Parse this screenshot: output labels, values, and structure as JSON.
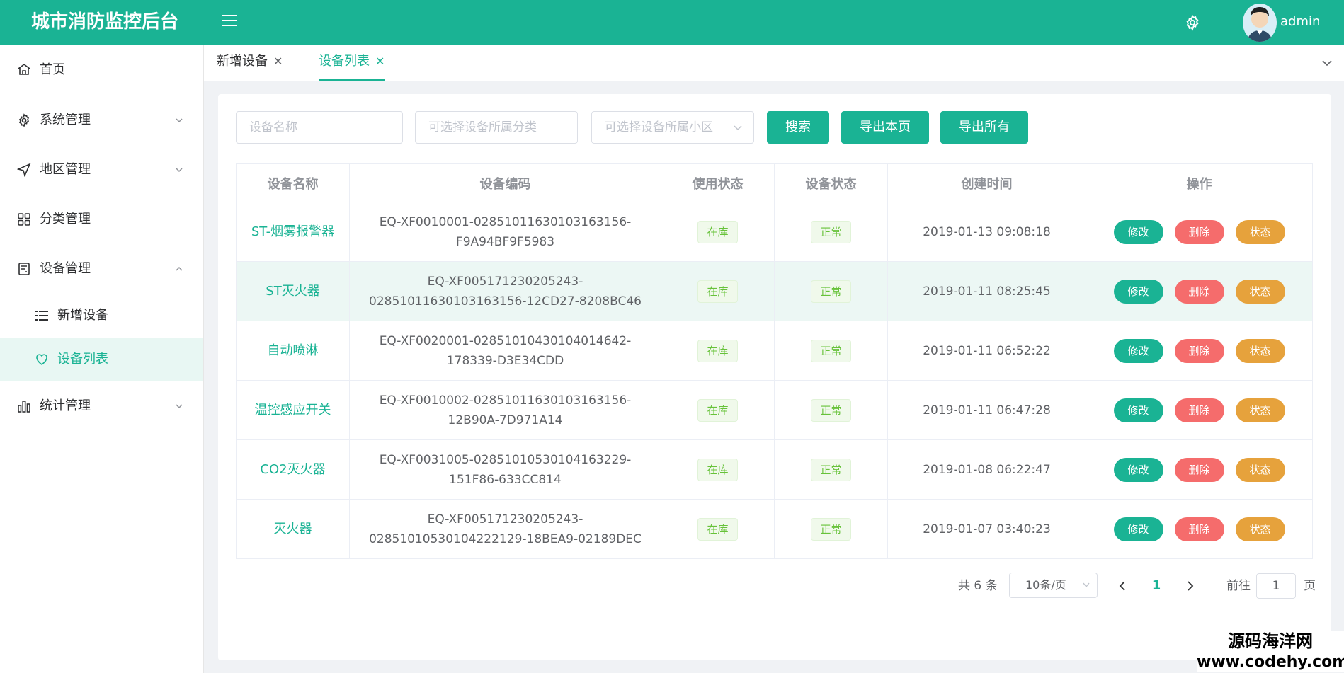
{
  "header": {
    "brand": "城市消防监控后台",
    "username": "admin"
  },
  "sidebar": {
    "items": [
      {
        "label": "首页",
        "icon": "home-icon"
      },
      {
        "label": "系统管理",
        "icon": "gear-icon"
      },
      {
        "label": "地区管理",
        "icon": "location-arrow-icon"
      },
      {
        "label": "分类管理",
        "icon": "grid-icon"
      },
      {
        "label": "设备管理",
        "icon": "device-icon"
      },
      {
        "label": "统计管理",
        "icon": "bar-chart-icon"
      }
    ],
    "sub_items": [
      {
        "label": "新增设备",
        "icon": "list-icon"
      },
      {
        "label": "设备列表",
        "icon": "heart-icon"
      }
    ]
  },
  "tabs": [
    {
      "label": "新增设备"
    },
    {
      "label": "设备列表"
    }
  ],
  "filters": {
    "name_placeholder": "设备名称",
    "category_placeholder": "可选择设备所属分类",
    "district_placeholder": "可选择设备所属小区",
    "search_label": "搜索",
    "export_page_label": "导出本页",
    "export_all_label": "导出所有"
  },
  "table": {
    "headers": [
      "设备名称",
      "设备编码",
      "使用状态",
      "设备状态",
      "创建时间",
      "操作"
    ],
    "rows": [
      {
        "name": "ST-烟雾报警器",
        "code": "EQ-XF0010001-02851011630103163156-F9A94BF9F5983",
        "usage": "在库",
        "status": "正常",
        "created": "2019-01-13 09:08:18"
      },
      {
        "name": "ST灭火器",
        "code": "EQ-XF005171230205243-02851011630103163156-12CD27-8208BC46",
        "usage": "在库",
        "status": "正常",
        "created": "2019-01-11 08:25:45"
      },
      {
        "name": "自动喷淋",
        "code": "EQ-XF0020001-02851010430104014642-178339-D3E34CDD",
        "usage": "在库",
        "status": "正常",
        "created": "2019-01-11 06:52:22"
      },
      {
        "name": "温控感应开关",
        "code": "EQ-XF0010002-02851011630103163156-12B90A-7D971A14",
        "usage": "在库",
        "status": "正常",
        "created": "2019-01-11 06:47:28"
      },
      {
        "name": "CO2灭火器",
        "code": "EQ-XF0031005-02851010530104163229-151F86-633CC814",
        "usage": "在库",
        "status": "正常",
        "created": "2019-01-08 06:22:47"
      },
      {
        "name": "灭火器",
        "code": "EQ-XF005171230205243-02851010530104222129-18BEA9-02189DEC",
        "usage": "在库",
        "status": "正常",
        "created": "2019-01-07 03:40:23"
      }
    ],
    "actions": {
      "edit": "修改",
      "delete": "删除",
      "state": "状态"
    }
  },
  "pagination": {
    "total_text": "共 6 条",
    "page_size": "10条/页",
    "current_page": "1",
    "goto_prefix": "前往",
    "goto_value": "1",
    "goto_suffix": "页"
  },
  "site_mark": {
    "line1": "源码海洋网",
    "line2": "www.codehy.com"
  },
  "colors": {
    "primary": "#1ab394",
    "danger": "#f56c6c",
    "warning": "#e6a23c",
    "success_tag": "#67c23a"
  }
}
